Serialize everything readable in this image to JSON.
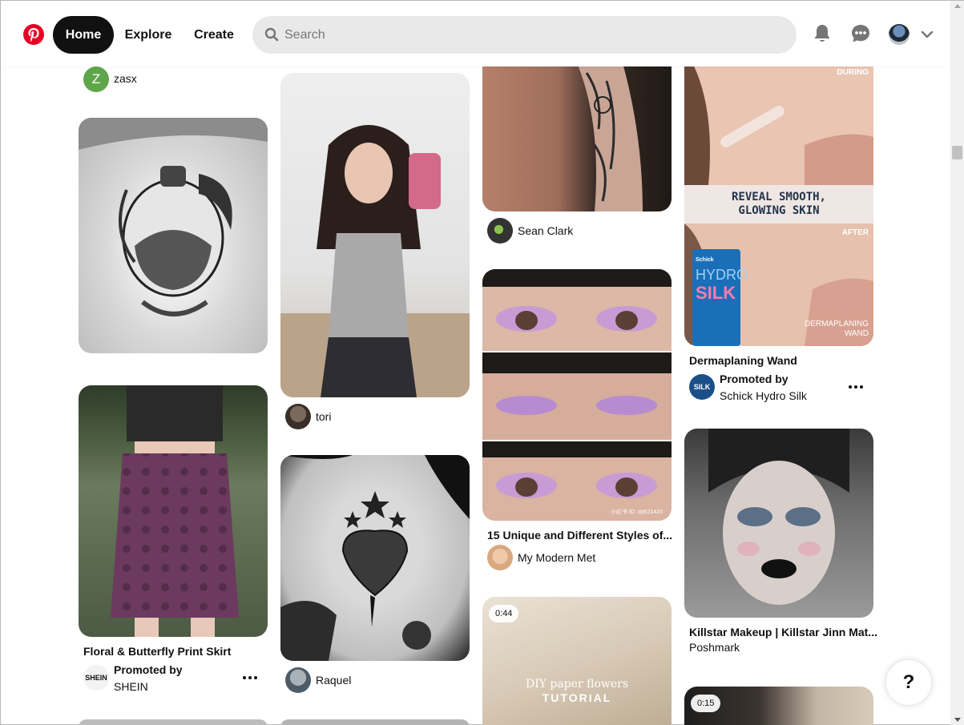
{
  "header": {
    "logo": "pinterest-logo",
    "nav": {
      "home": "Home",
      "explore": "Explore",
      "create": "Create"
    },
    "search": {
      "placeholder": "Search"
    },
    "icons": [
      "bell-icon",
      "message-icon",
      "avatar",
      "chevron-down-icon"
    ]
  },
  "pins": {
    "col1": [
      {
        "creator": "zasx",
        "avatar_letter": "Z"
      },
      {
        "image": "tattoo-potion-bottle"
      },
      {
        "image": "floral-butterfly-skirt",
        "title": "Floral & Butterfly Print Skirt",
        "promoted_label": "Promoted by",
        "promoter": "SHEIN",
        "avatar_text": "SHEIN"
      }
    ],
    "col2": [
      {
        "image": "mirror-selfie",
        "creator": "tori"
      },
      {
        "image": "snake-tattoo",
        "creator": "Raquel"
      }
    ],
    "col3": [
      {
        "image": "arm-tattoo",
        "creator": "Sean Clark"
      },
      {
        "image": "eye-makeup",
        "title": "15 Unique and Different Styles of...",
        "creator": "My Modern Met",
        "watermark": "小红书 ID: dyfr21420"
      },
      {
        "image": "diy-paper-flowers-video",
        "duration": "0:44",
        "overlay_line1": "DIY paper flowers",
        "overlay_line2": "TUTORIAL"
      }
    ],
    "col4": [
      {
        "image": "dermaplaning-ad",
        "ad_top_label": "DURING",
        "ad_headline_1": "REVEAL SMOOTH,",
        "ad_headline_2": "GLOWING SKIN",
        "ad_after_label": "AFTER",
        "ad_brand_1": "Schick",
        "ad_brand_2": "HYDRO",
        "ad_brand_3": "SILK",
        "ad_bottom_label_1": "DERMAPLANING",
        "ad_bottom_label_2": "WAND",
        "title": "Dermaplaning Wand",
        "promoted_label": "Promoted by",
        "promoter": "Schick Hydro Silk",
        "avatar_text": "SILK"
      },
      {
        "image": "goth-makeup",
        "title": "Killstar Makeup | Killstar Jinn Mat...",
        "creator": "Poshmark"
      },
      {
        "image": "video-pin",
        "duration": "0:15"
      }
    ]
  },
  "help": {
    "label": "?"
  }
}
